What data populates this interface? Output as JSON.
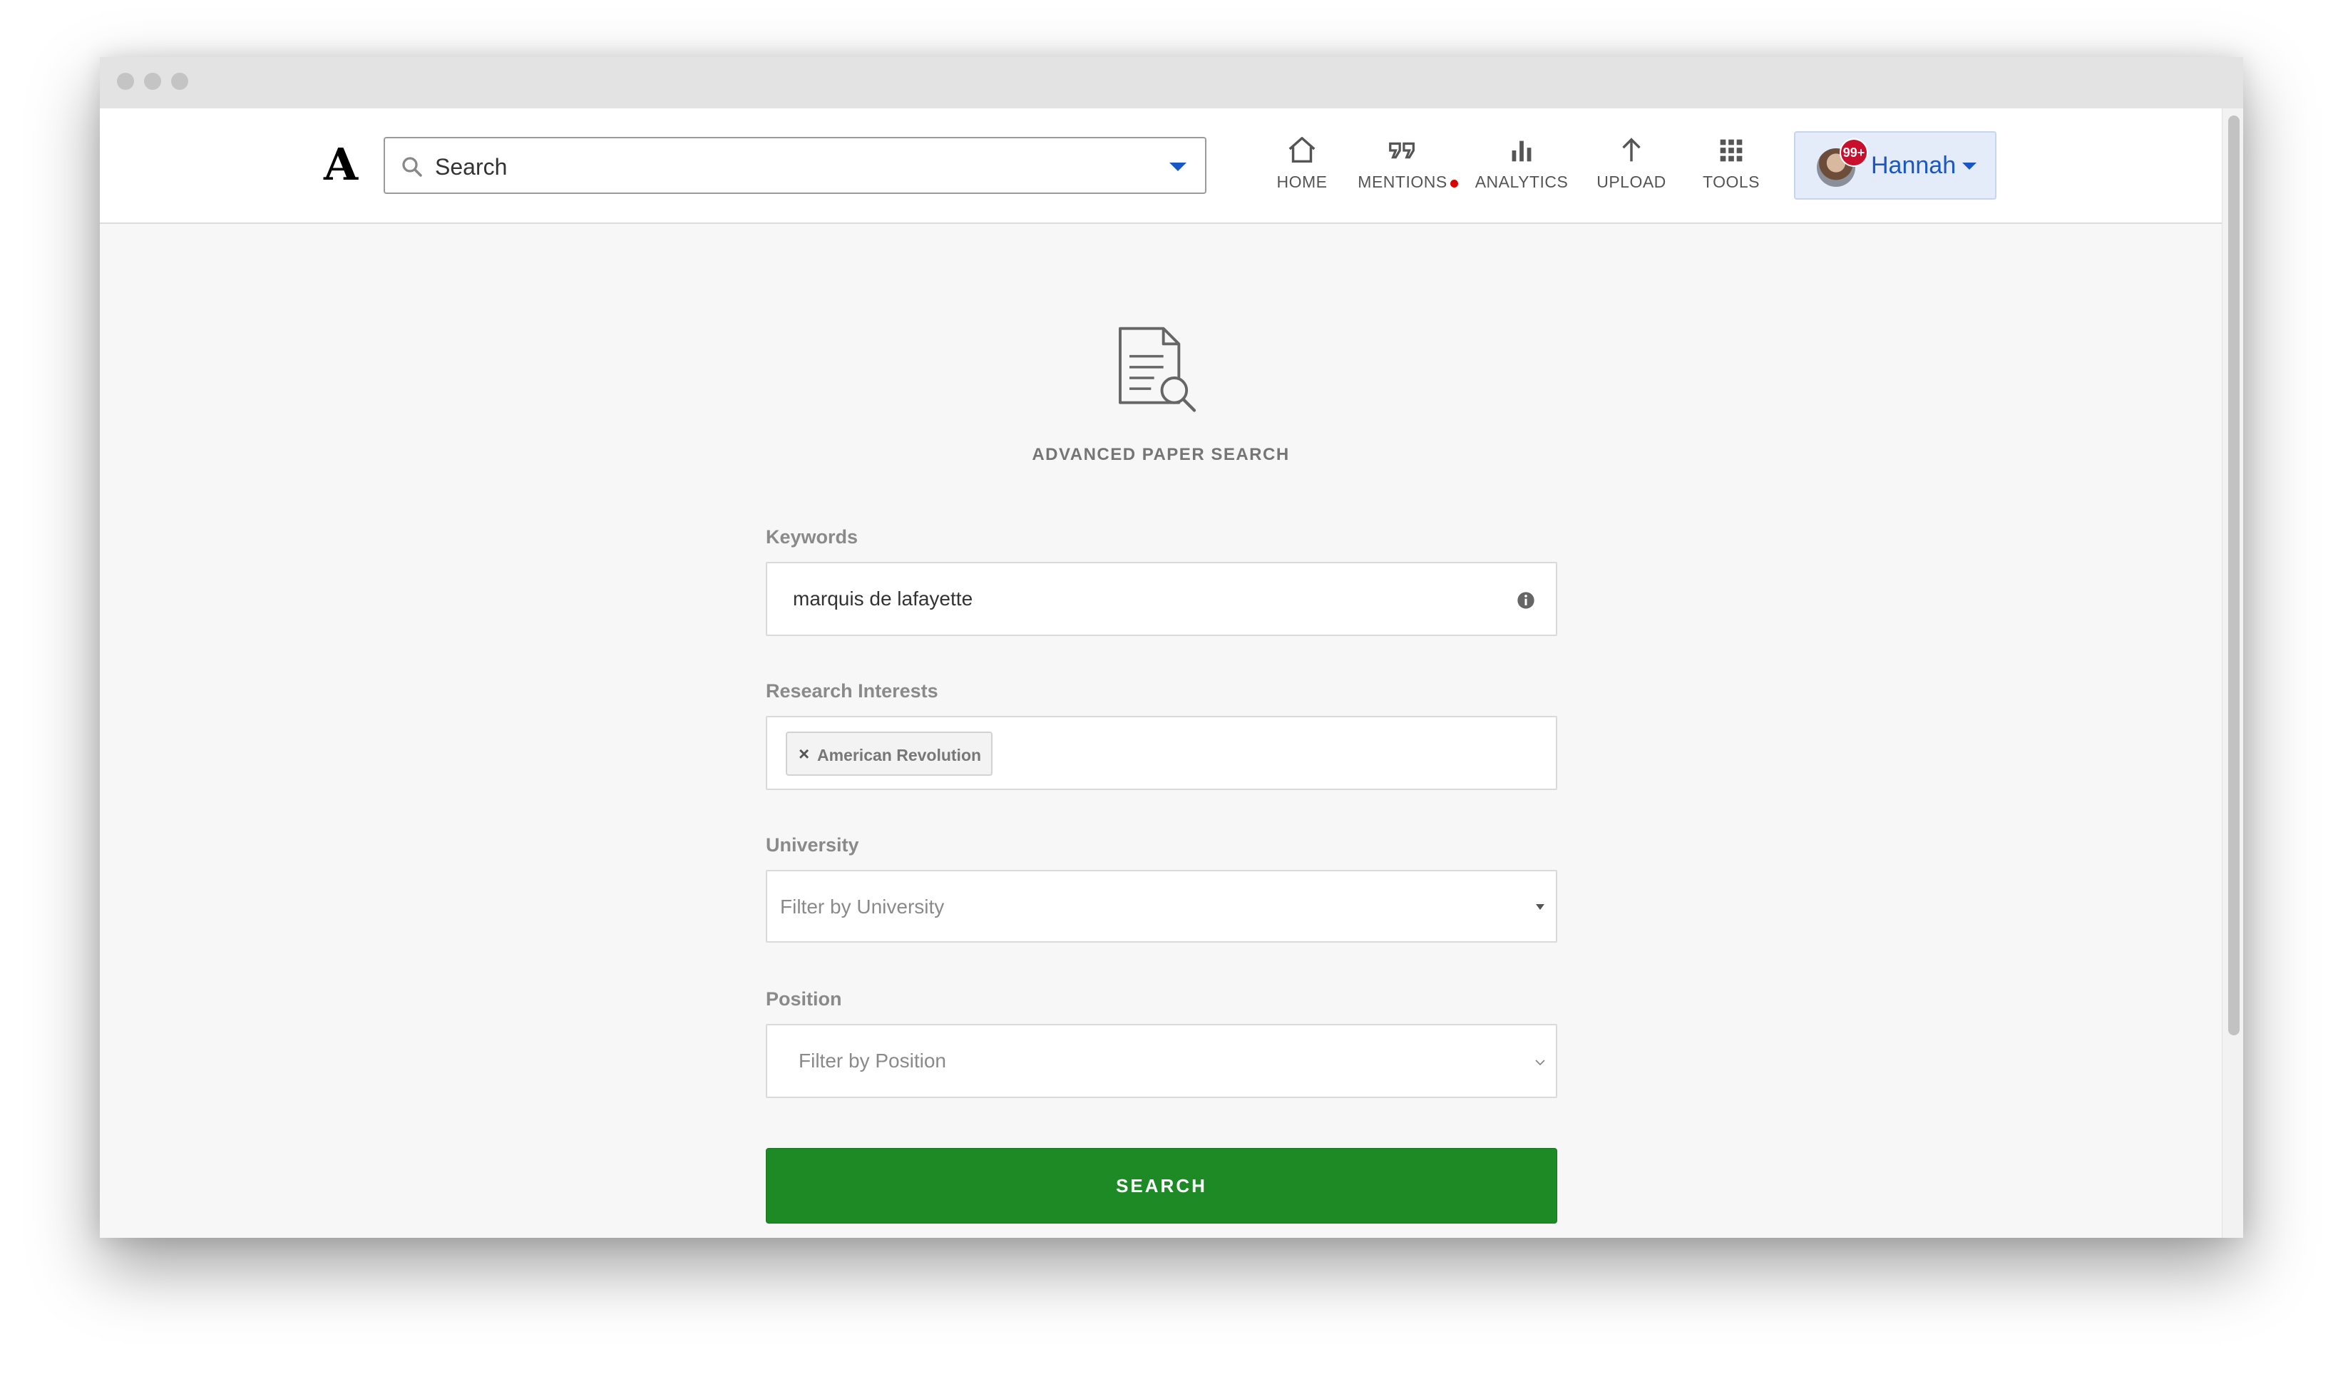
{
  "navbar": {
    "logo": "A",
    "search": {
      "placeholder": "Search"
    },
    "items": [
      {
        "label": "HOME",
        "icon": "home-icon"
      },
      {
        "label": "MENTIONS",
        "icon": "quote-icon",
        "has_notification_dot": true
      },
      {
        "label": "ANALYTICS",
        "icon": "bar-chart-icon"
      },
      {
        "label": "UPLOAD",
        "icon": "arrow-up-icon"
      },
      {
        "label": "TOOLS",
        "icon": "grid-icon"
      }
    ],
    "user": {
      "name": "Hannah",
      "badge": "99+"
    }
  },
  "page": {
    "title": "ADVANCED PAPER SEARCH",
    "keywords": {
      "label": "Keywords",
      "value": "marquis de lafayette"
    },
    "research_interests": {
      "label": "Research Interests",
      "chips": [
        {
          "remove": "×",
          "label": "American Revolution"
        }
      ]
    },
    "university": {
      "label": "University",
      "placeholder": "Filter by University"
    },
    "position": {
      "label": "Position",
      "placeholder": "Filter by Position"
    },
    "submit_label": "SEARCH"
  },
  "colors": {
    "accent_blue": "#1a57c6",
    "search_button": "#1d8a26",
    "notification_red": "#c8102e"
  }
}
